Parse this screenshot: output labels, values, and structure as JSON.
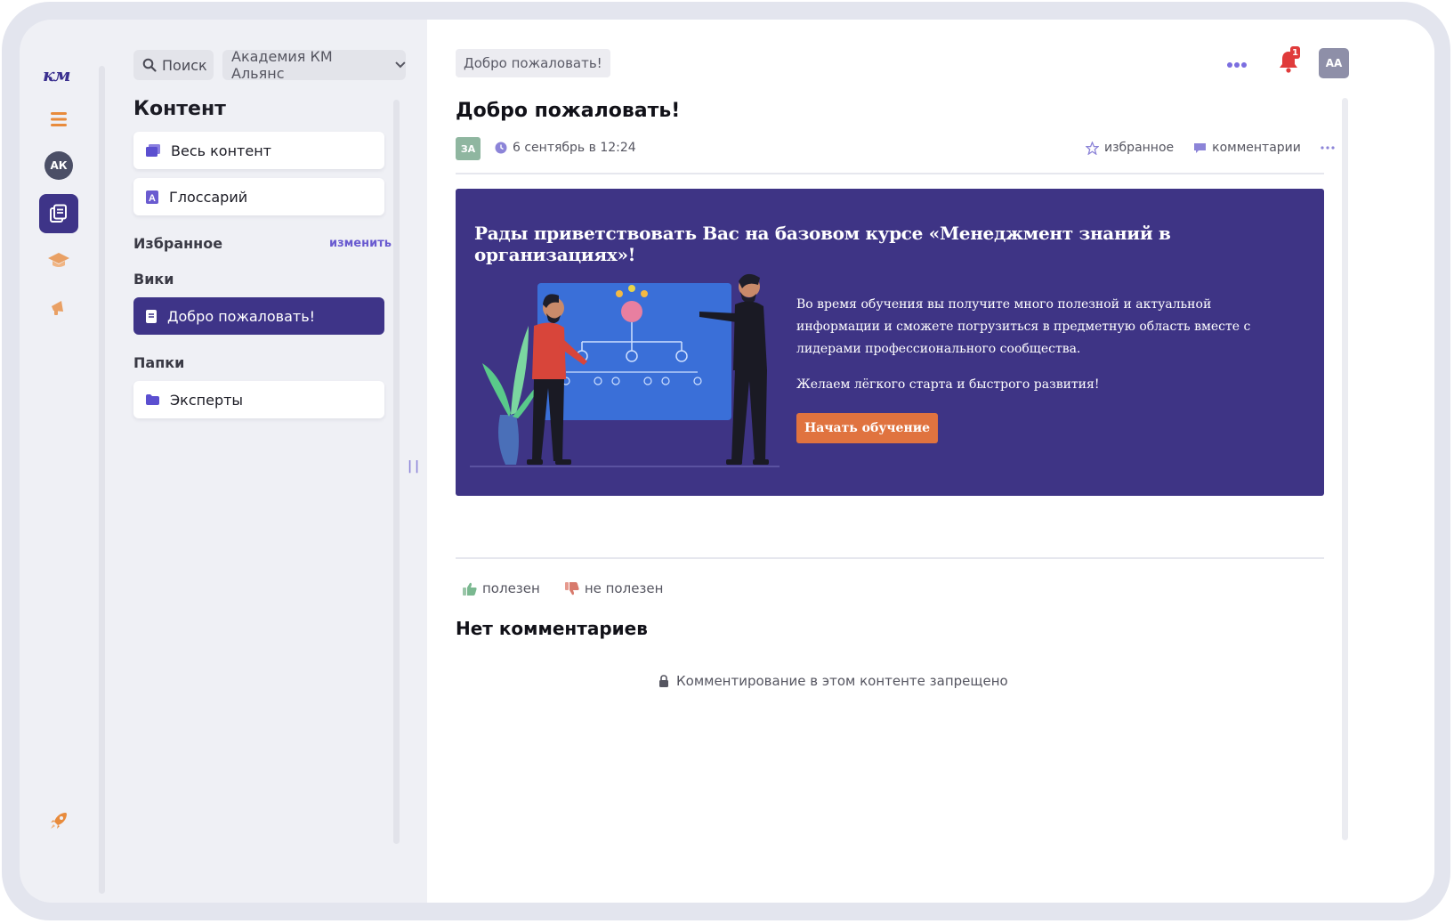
{
  "rail": {
    "logo": "км",
    "avatar_initials": "АК",
    "colors": {
      "accent": "#3e3488",
      "orange": "#e88b3c"
    }
  },
  "panel": {
    "search_label": "Поиск",
    "org_select_value": "Академия КМ Альянс",
    "title": "Контент",
    "all_content": "Весь контент",
    "glossary": "Глоссарий",
    "favorites_label": "Избранное",
    "favorites_edit": "изменить",
    "wiki_label": "Вики",
    "wiki_items": [
      {
        "label": "Добро пожаловать!",
        "active": true
      }
    ],
    "folders_label": "Папки",
    "folder_items": [
      {
        "label": "Эксперты"
      }
    ]
  },
  "topbar": {
    "breadcrumb": "Добро пожаловать!",
    "notifications_count": "1",
    "user_initials": "АА"
  },
  "article": {
    "title": "Добро пожаловать!",
    "author_initials": "ЗА",
    "date": "6 сентябрь в 12:24",
    "favorite_label": "избранное",
    "comments_label": "комментарии",
    "banner": {
      "heading": "Рады приветствовать Вас на базовом курсе «Менеджмент знаний в организациях»!",
      "line1": "Во время обучения вы получите много полезной и актуальной",
      "line2": "информации и сможете погрузиться в предметную область вместе с",
      "line3": "лидерами профессионального сообщества.",
      "wish": "Желаем лёгкого старта и быстрого развития!",
      "button": "Начать обучение",
      "bg_color": "#3e3485",
      "button_color": "#e0733f"
    },
    "useful_label": "полезен",
    "not_useful_label": "не полезен",
    "comments_heading": "Нет комментариев",
    "comments_disabled": "Комментирование в этом контенте запрещено"
  }
}
